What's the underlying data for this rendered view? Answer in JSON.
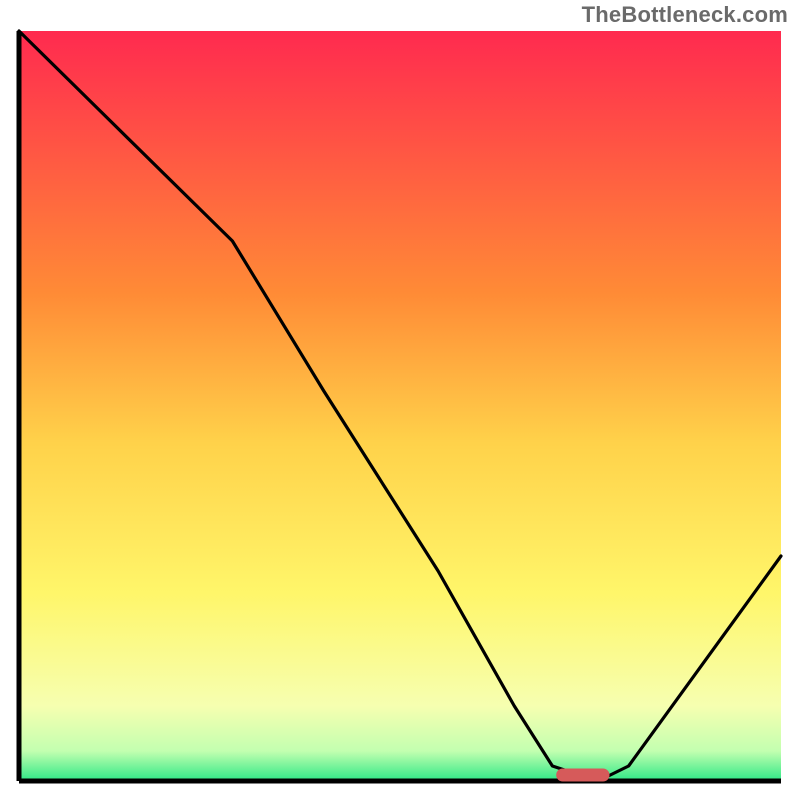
{
  "watermark": "TheBottleneck.com",
  "chart_data": {
    "type": "line",
    "title": "",
    "xlabel": "",
    "ylabel": "",
    "xlim": [
      0,
      100
    ],
    "ylim": [
      0,
      100
    ],
    "grid": false,
    "legend": false,
    "background_gradient": {
      "stops": [
        {
          "offset": 0,
          "color": "#ff2a4f"
        },
        {
          "offset": 35,
          "color": "#ff8b36"
        },
        {
          "offset": 55,
          "color": "#ffd24a"
        },
        {
          "offset": 75,
          "color": "#fff66a"
        },
        {
          "offset": 90,
          "color": "#f6ffb0"
        },
        {
          "offset": 96,
          "color": "#c3ffb0"
        },
        {
          "offset": 100,
          "color": "#2ee886"
        }
      ]
    },
    "series": [
      {
        "name": "bottleneck-curve",
        "color": "#000000",
        "x": [
          0,
          12,
          22,
          28,
          40,
          55,
          65,
          70,
          76,
          80,
          100
        ],
        "values": [
          100,
          88,
          78,
          72,
          52,
          28,
          10,
          2,
          0,
          2,
          30
        ]
      }
    ],
    "marker": {
      "name": "optimum-marker",
      "color": "#d65a5a",
      "x_center": 74,
      "width": 7,
      "y": 0.8
    }
  }
}
